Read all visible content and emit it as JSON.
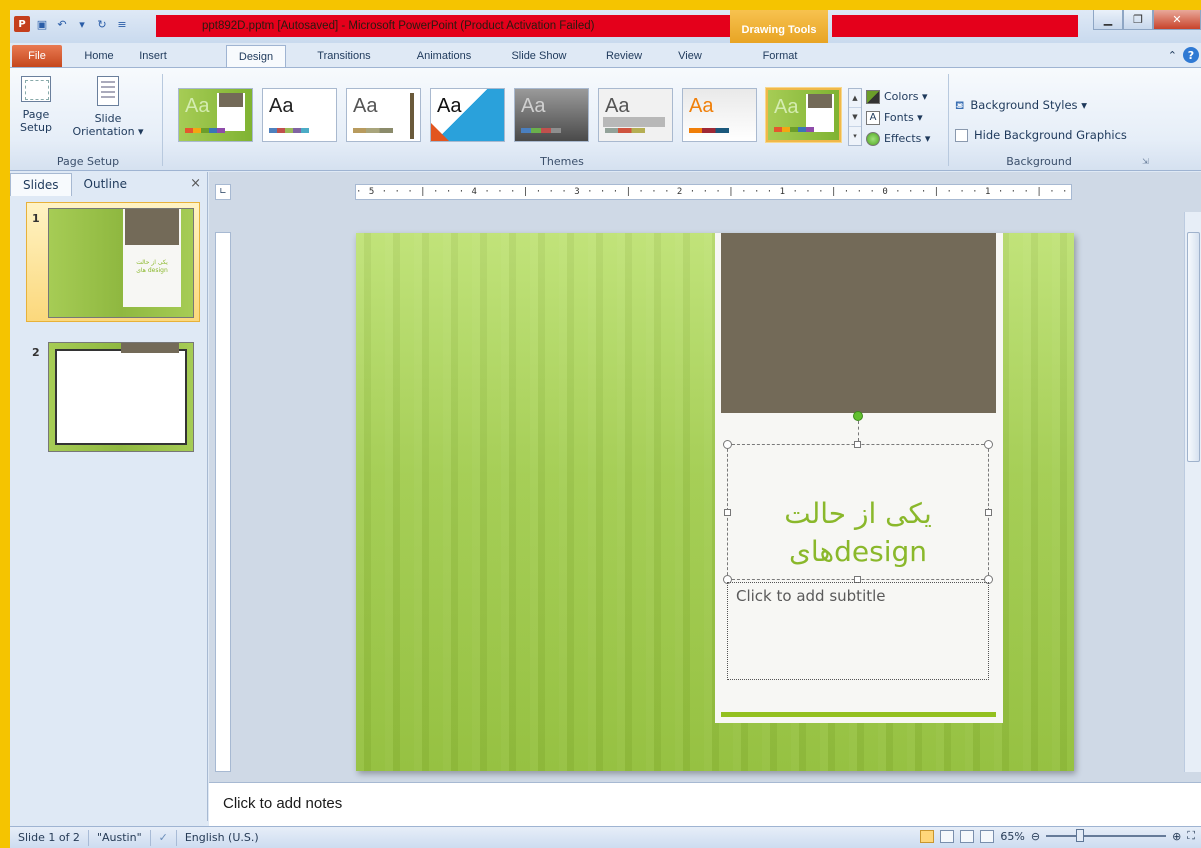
{
  "window": {
    "title": "ppt892D.pptm [Autosaved] - Microsoft PowerPoint (Product Activation Failed)",
    "contextual_tab_group": "Drawing Tools"
  },
  "tabs": [
    {
      "label": "File"
    },
    {
      "label": "Home"
    },
    {
      "label": "Insert"
    },
    {
      "label": "Design"
    },
    {
      "label": "Transitions"
    },
    {
      "label": "Animations"
    },
    {
      "label": "Slide Show"
    },
    {
      "label": "Review"
    },
    {
      "label": "View"
    },
    {
      "label": "Format"
    }
  ],
  "active_tab": "Design",
  "ribbon": {
    "page_setup": {
      "page_setup_label_1": "Page",
      "page_setup_label_2": "Setup",
      "orientation_label_1": "Slide",
      "orientation_label_2": "Orientation ▾",
      "group_label": "Page Setup"
    },
    "themes": {
      "group_label": "Themes",
      "thumbnail_text": "Aa",
      "options": [
        "Colors ▾",
        "Fonts ▾",
        "Effects ▾"
      ]
    },
    "background": {
      "styles_label": "Background Styles ▾",
      "hide_label": "Hide Background Graphics",
      "group_label": "Background"
    }
  },
  "left_pane": {
    "tab_slides": "Slides",
    "tab_outline": "Outline",
    "close": "×",
    "slide_numbers": [
      "1",
      "2"
    ],
    "thumb1_line1": "یکی از حالت",
    "thumb1_line2": "های design"
  },
  "ruler": {
    "horizontal": "· 5 · · · | · · · 4 · · · | · · · 3 · · · | · · · 2 · · · | · · · 1 · · · | · · · 0 · · · | · · · 1 · · · | · · · 2 · · · | · · · 3 · · · | · · · 4 · · · |"
  },
  "slide": {
    "title_line1": "یکی از حالت",
    "title_line2": "هایdesign",
    "subtitle_placeholder": "Click to add subtitle"
  },
  "notes": {
    "placeholder": "Click to add notes"
  },
  "status": {
    "slide_info": "Slide 1 of 2",
    "theme_name": "\"Austin\"",
    "language": "English (U.S.)",
    "zoom": "65%"
  },
  "colors": {
    "slide_green": "#a3cd52",
    "brown_box": "#736a58",
    "title_green": "#8ab82b",
    "title_bar_red": "#e4001b",
    "highlight_frame": "#f5c400"
  }
}
